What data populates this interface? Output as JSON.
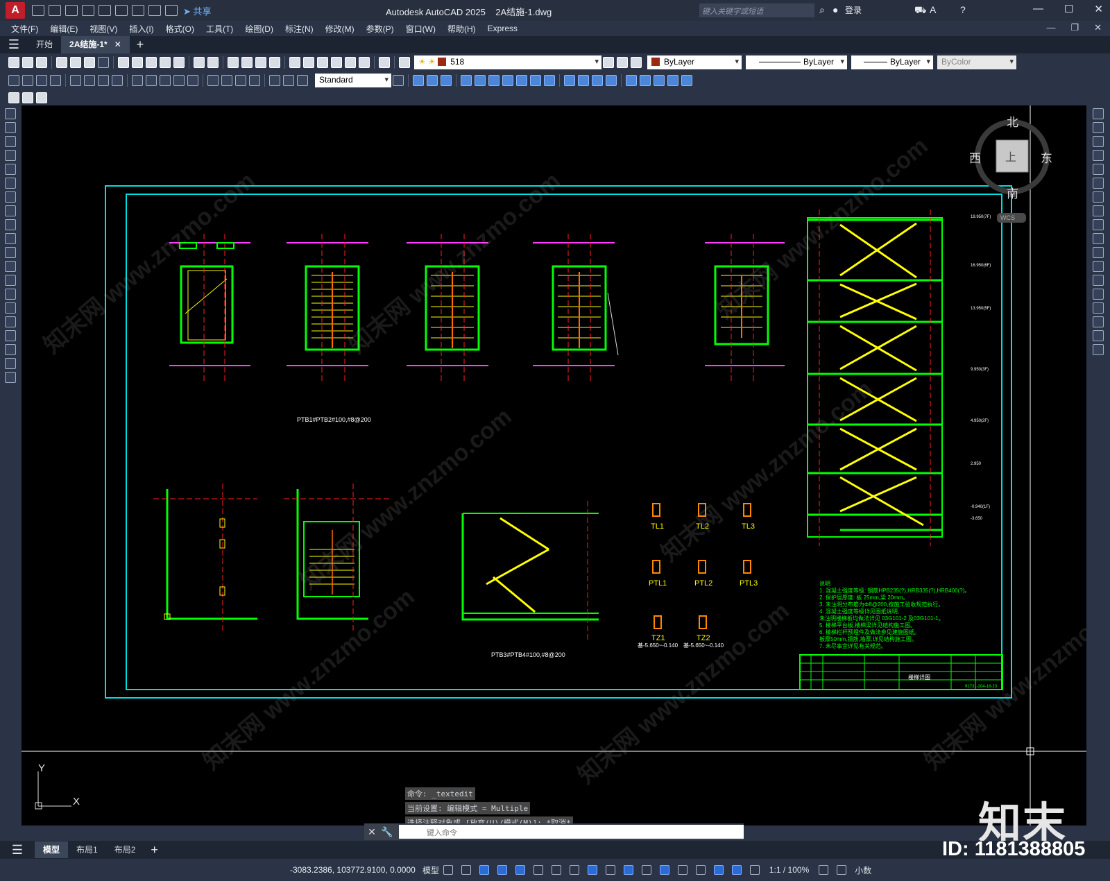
{
  "title_bar": {
    "app_button": "A",
    "app_name": "Autodesk AutoCAD 2025",
    "file_name": "2A结施-1.dwg",
    "share_label": "共享",
    "search_placeholder": "键入关键字或短语",
    "login_label": "登录"
  },
  "menu": [
    "文件(F)",
    "编辑(E)",
    "视图(V)",
    "插入(I)",
    "格式(O)",
    "工具(T)",
    "绘图(D)",
    "标注(N)",
    "修改(M)",
    "参数(P)",
    "窗口(W)",
    "帮助(H)",
    "Express"
  ],
  "doc_tabs": {
    "start": "开始",
    "active": "2A结施-1*"
  },
  "properties": {
    "layer": "518",
    "color": "ByLayer",
    "linetype": "ByLayer",
    "lineweight": "ByLayer",
    "plotstyle": "ByColor",
    "textstyle": "Standard",
    "layer_color": "#9c2a13"
  },
  "viewcube": {
    "north": "北",
    "south": "南",
    "east": "东",
    "west": "西",
    "top": "上",
    "wcs": "WCS"
  },
  "ucs": {
    "x": "X",
    "y": "Y"
  },
  "drawing": {
    "label_ptb12": "PTB1#PTB2#100,#8@200",
    "label_ptb34": "PTB3#PTB4#100,#8@200",
    "beams": [
      "TL1",
      "TL2",
      "TL3",
      "PTL1",
      "PTL2",
      "PTL3",
      "TZ1",
      "TZ2"
    ],
    "tz_note": "基-5.650~-0.140",
    "notes_title": "说明",
    "notes": [
      "1. 混凝土强度等级: 钢筋HPB235(?),HRB335(?),HRB400(?)。",
      "2. 保护层厚度: 板 25mm,梁 20mm。",
      "3. 未注明分布筋为Φ8@200,按施工验收规范执行。",
      "4. 混凝土强度等级详见图纸说明,",
      "   未注明楼梯板均做法详见 03G101-2 及03G101-1。",
      "5. 楼梯平台板,楼梯梁详见结构施工图。",
      "6. 楼梯栏杆预埋件及做法参见建施图纸。",
      "   板厚50mm,钢筋,墙厚,详见结构施工图。",
      "7. 未尽事宜详见有关规范。"
    ],
    "titleblock_name": "楼梯详图",
    "titleblock_code": "91731-204-18-23",
    "levels": [
      "19.950(7F)",
      "16.950(6F)",
      "13.950(5F)",
      "9.950(3F)",
      "4.950(2F)",
      "2.950",
      "-0.940(1F)",
      "-3.650"
    ]
  },
  "command": {
    "history": [
      "命令: _textedit",
      "当前设置: 编辑模式 = Multiple",
      "选择注释对象或 [放弃(U)/模式(M)]: *取消*"
    ],
    "placeholder": "键入命令"
  },
  "layout_tabs": [
    "模型",
    "布局1",
    "布局2"
  ],
  "status": {
    "coords": "-3083.2386, 103772.9100, 0.0000",
    "model": "模型",
    "scale": "1:1 / 100%",
    "units": "小数"
  },
  "brand": "知末",
  "id_label": "ID: 1181388805",
  "watermark": "知末网 www.znzmo.com"
}
